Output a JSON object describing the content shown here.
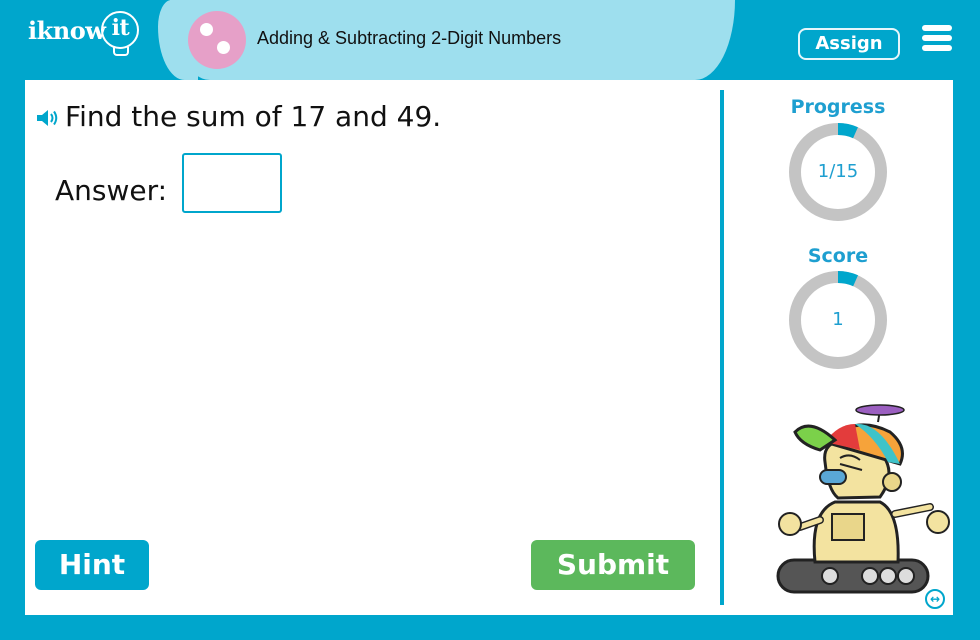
{
  "header": {
    "logo_text": "iknow",
    "logo_bulb_text": "it",
    "topic_title": "Adding & Subtracting 2-Digit Numbers",
    "topic_icon": "two-dots-icon",
    "assign_label": "Assign",
    "menu_icon": "hamburger-menu-icon"
  },
  "question": {
    "speaker_icon": "speaker-icon",
    "text": "Find the sum of 17 and 49.",
    "answer_label": "Answer:",
    "answer_value": "",
    "answer_placeholder": ""
  },
  "buttons": {
    "hint_label": "Hint",
    "submit_label": "Submit"
  },
  "sidebar": {
    "progress": {
      "label": "Progress",
      "text": "1/15",
      "current": 1,
      "total": 15
    },
    "score": {
      "label": "Score",
      "text": "1",
      "fraction": 0.067
    },
    "expand_icon": "expand-horizontal-icon"
  },
  "colors": {
    "primary": "#00a6cc",
    "title_bar": "#9edfee",
    "topic_icon": "#e6a0c8",
    "submit": "#5cb85c",
    "ring_track": "#c4c4c4",
    "ring_fill": "#00a6cc",
    "label_blue": "#1e9fd0"
  }
}
